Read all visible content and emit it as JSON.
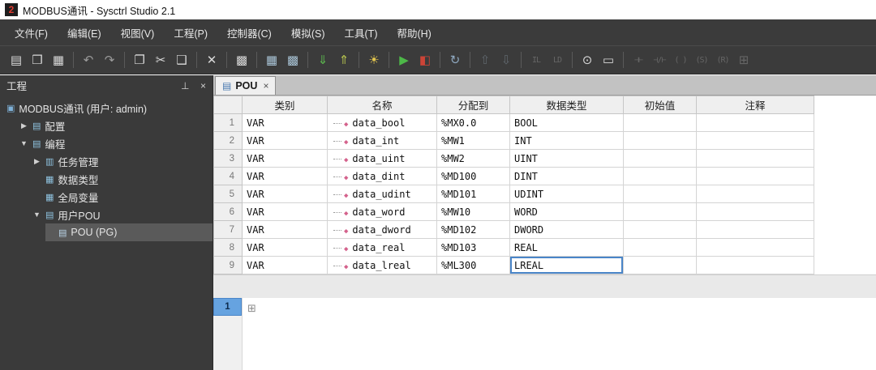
{
  "window": {
    "title": "MODBUS通讯 - Sysctrl Studio 2.1",
    "logo_glyph": "2"
  },
  "menu": {
    "items": [
      {
        "key": "file",
        "label": "文件(F)"
      },
      {
        "key": "edit",
        "label": "编辑(E)"
      },
      {
        "key": "view",
        "label": "视图(V)"
      },
      {
        "key": "project",
        "label": "工程(P)"
      },
      {
        "key": "controller",
        "label": "控制器(C)"
      },
      {
        "key": "simulation",
        "label": "模拟(S)"
      },
      {
        "key": "tools",
        "label": "工具(T)"
      },
      {
        "key": "help",
        "label": "帮助(H)"
      }
    ]
  },
  "toolbar": {
    "items": [
      {
        "name": "new-file-icon",
        "glyph": "▤",
        "color": "#d9d9d9"
      },
      {
        "name": "open-project-icon",
        "glyph": "❒",
        "color": "#d9d9d9"
      },
      {
        "name": "save-icon",
        "glyph": "▦",
        "color": "#d9d9d9"
      },
      {
        "sep": true
      },
      {
        "name": "undo-icon",
        "glyph": "↶",
        "color": "#9a9a9a"
      },
      {
        "name": "redo-icon",
        "glyph": "↷",
        "color": "#9a9a9a"
      },
      {
        "sep": true
      },
      {
        "name": "copy-icon",
        "glyph": "❐",
        "color": "#d9d9d9"
      },
      {
        "name": "cut-icon",
        "glyph": "✂",
        "color": "#d9d9d9"
      },
      {
        "name": "paste-icon",
        "glyph": "❑",
        "color": "#d9d9d9"
      },
      {
        "sep": true
      },
      {
        "name": "delete-icon",
        "glyph": "✕",
        "color": "#d9d9d9"
      },
      {
        "sep": true
      },
      {
        "name": "library-icon",
        "glyph": "▩",
        "color": "#d9d9d9"
      },
      {
        "sep": true
      },
      {
        "name": "compile-icon",
        "glyph": "▦",
        "color": "#a9c4d6"
      },
      {
        "name": "rebuild-icon",
        "glyph": "▩",
        "color": "#a9c4d6"
      },
      {
        "sep": true
      },
      {
        "name": "import-library-icon",
        "glyph": "⇓",
        "color": "#5cb64e"
      },
      {
        "name": "export-library-icon",
        "glyph": "⇑",
        "color": "#b5c24e"
      },
      {
        "sep": true
      },
      {
        "name": "debug-icon",
        "glyph": "☀",
        "color": "#e4c64e"
      },
      {
        "sep": true
      },
      {
        "name": "run-icon",
        "glyph": "▶",
        "color": "#4db848"
      },
      {
        "name": "online-icon",
        "glyph": "◧",
        "color": "#cc4437"
      },
      {
        "sep": true
      },
      {
        "name": "sync-icon",
        "glyph": "↻",
        "color": "#8fa8c0"
      },
      {
        "sep": true
      },
      {
        "name": "move-up-icon",
        "glyph": "⇧",
        "color": "#8b9aa8",
        "disabled": true
      },
      {
        "name": "move-down-icon",
        "glyph": "⇩",
        "color": "#8b9aa8",
        "disabled": true
      },
      {
        "sep": true
      },
      {
        "name": "il-view-icon",
        "glyph": "IL",
        "color": "#9a9a9a",
        "disabled": true,
        "small": true
      },
      {
        "name": "ld-view-icon",
        "glyph": "LD",
        "color": "#9a9a9a",
        "disabled": true,
        "small": true
      },
      {
        "sep": true
      },
      {
        "name": "monitor-icon",
        "glyph": "⊙",
        "color": "#d9d9d9"
      },
      {
        "name": "function-block-icon",
        "glyph": "▭",
        "color": "#d9d9d9"
      },
      {
        "sep": true
      },
      {
        "name": "contact-no-icon",
        "glyph": "⊣⊢",
        "color": "#9a9a9a",
        "disabled": true,
        "small": true
      },
      {
        "name": "contact-nc-icon",
        "glyph": "⊣/⊢",
        "color": "#9a9a9a",
        "disabled": true,
        "small": true
      },
      {
        "name": "coil-icon",
        "glyph": "( )",
        "color": "#9a9a9a",
        "disabled": true,
        "small": true
      },
      {
        "name": "set-coil-icon",
        "glyph": "(S)",
        "color": "#9a9a9a",
        "disabled": true,
        "small": true
      },
      {
        "name": "reset-coil-icon",
        "glyph": "(R)",
        "color": "#9a9a9a",
        "disabled": true,
        "small": true
      },
      {
        "name": "network-icon",
        "glyph": "⊞",
        "color": "#9a9a9a",
        "disabled": true
      }
    ]
  },
  "project_panel": {
    "title": "工程",
    "pin_glyph": "⊥",
    "close_glyph": "×",
    "items": [
      {
        "name": "tree-root-project",
        "label": "MODBUS通讯 (用户: admin)",
        "icon": "project-icon",
        "glyph": "▣",
        "color": "#7fb2d9",
        "indent": 0,
        "arrow": ""
      },
      {
        "name": "tree-item-config",
        "label": "配置",
        "icon": "config-icon",
        "glyph": "▤",
        "color": "#8fc3e0",
        "indent": 1,
        "arrow": "▶"
      },
      {
        "name": "tree-item-programming",
        "label": "编程",
        "icon": "programming-icon",
        "glyph": "▤",
        "color": "#8fc3e0",
        "indent": 1,
        "arrow": "▼"
      },
      {
        "name": "tree-item-task-management",
        "label": "任务管理",
        "icon": "task-icon",
        "glyph": "▥",
        "color": "#8fc3e0",
        "indent": 2,
        "arrow": "▶"
      },
      {
        "name": "tree-item-data-types",
        "label": "数据类型",
        "icon": "datatype-icon",
        "glyph": "▦",
        "color": "#8fc3e0",
        "indent": 2,
        "arrow": ""
      },
      {
        "name": "tree-item-global-vars",
        "label": "全局变量",
        "icon": "globalvar-icon",
        "glyph": "▦",
        "color": "#8fc3e0",
        "indent": 2,
        "arrow": ""
      },
      {
        "name": "tree-item-user-pou",
        "label": "用户POU",
        "icon": "pou-folder-icon",
        "glyph": "▤",
        "color": "#8fc3e0",
        "indent": 2,
        "arrow": "▼"
      },
      {
        "name": "tree-item-pou",
        "label": "POU (PG)",
        "icon": "pou-icon",
        "glyph": "▤",
        "color": "#bcd6ea",
        "indent": 3,
        "arrow": "",
        "selected": true
      }
    ]
  },
  "editor": {
    "tab_label": "POU",
    "tab_icon_glyph": "▤",
    "tab_close_glyph": "×",
    "table": {
      "var_icon_glyph": "◆",
      "headers": [
        {
          "key": "category",
          "label": "类别"
        },
        {
          "key": "name",
          "label": "名称"
        },
        {
          "key": "address",
          "label": "分配到"
        },
        {
          "key": "type",
          "label": "数据类型"
        },
        {
          "key": "init",
          "label": "初始值"
        },
        {
          "key": "comment",
          "label": "注释"
        }
      ],
      "rows": [
        {
          "num": "1",
          "category": "VAR",
          "name": "data_bool",
          "address": "%MX0.0",
          "type": "BOOL",
          "init": "",
          "comment": ""
        },
        {
          "num": "2",
          "category": "VAR",
          "name": "data_int",
          "address": "%MW1",
          "type": "INT",
          "init": "",
          "comment": ""
        },
        {
          "num": "3",
          "category": "VAR",
          "name": "data_uint",
          "address": "%MW2",
          "type": "UINT",
          "init": "",
          "comment": ""
        },
        {
          "num": "4",
          "category": "VAR",
          "name": "data_dint",
          "address": "%MD100",
          "type": "DINT",
          "init": "",
          "comment": ""
        },
        {
          "num": "5",
          "category": "VAR",
          "name": "data_udint",
          "address": "%MD101",
          "type": "UDINT",
          "init": "",
          "comment": ""
        },
        {
          "num": "6",
          "category": "VAR",
          "name": "data_word",
          "address": "%MW10",
          "type": "WORD",
          "init": "",
          "comment": ""
        },
        {
          "num": "7",
          "category": "VAR",
          "name": "data_dword",
          "address": "%MD102",
          "type": "DWORD",
          "init": "",
          "comment": ""
        },
        {
          "num": "8",
          "category": "VAR",
          "name": "data_real",
          "address": "%MD103",
          "type": "REAL",
          "init": "",
          "comment": ""
        },
        {
          "num": "9",
          "category": "VAR",
          "name": "data_lreal",
          "address": "%ML300",
          "type": "LREAL",
          "init": "",
          "comment": "",
          "type_selected": true
        }
      ]
    },
    "code": {
      "line_no": "1",
      "expand_glyph": "⊞"
    }
  }
}
